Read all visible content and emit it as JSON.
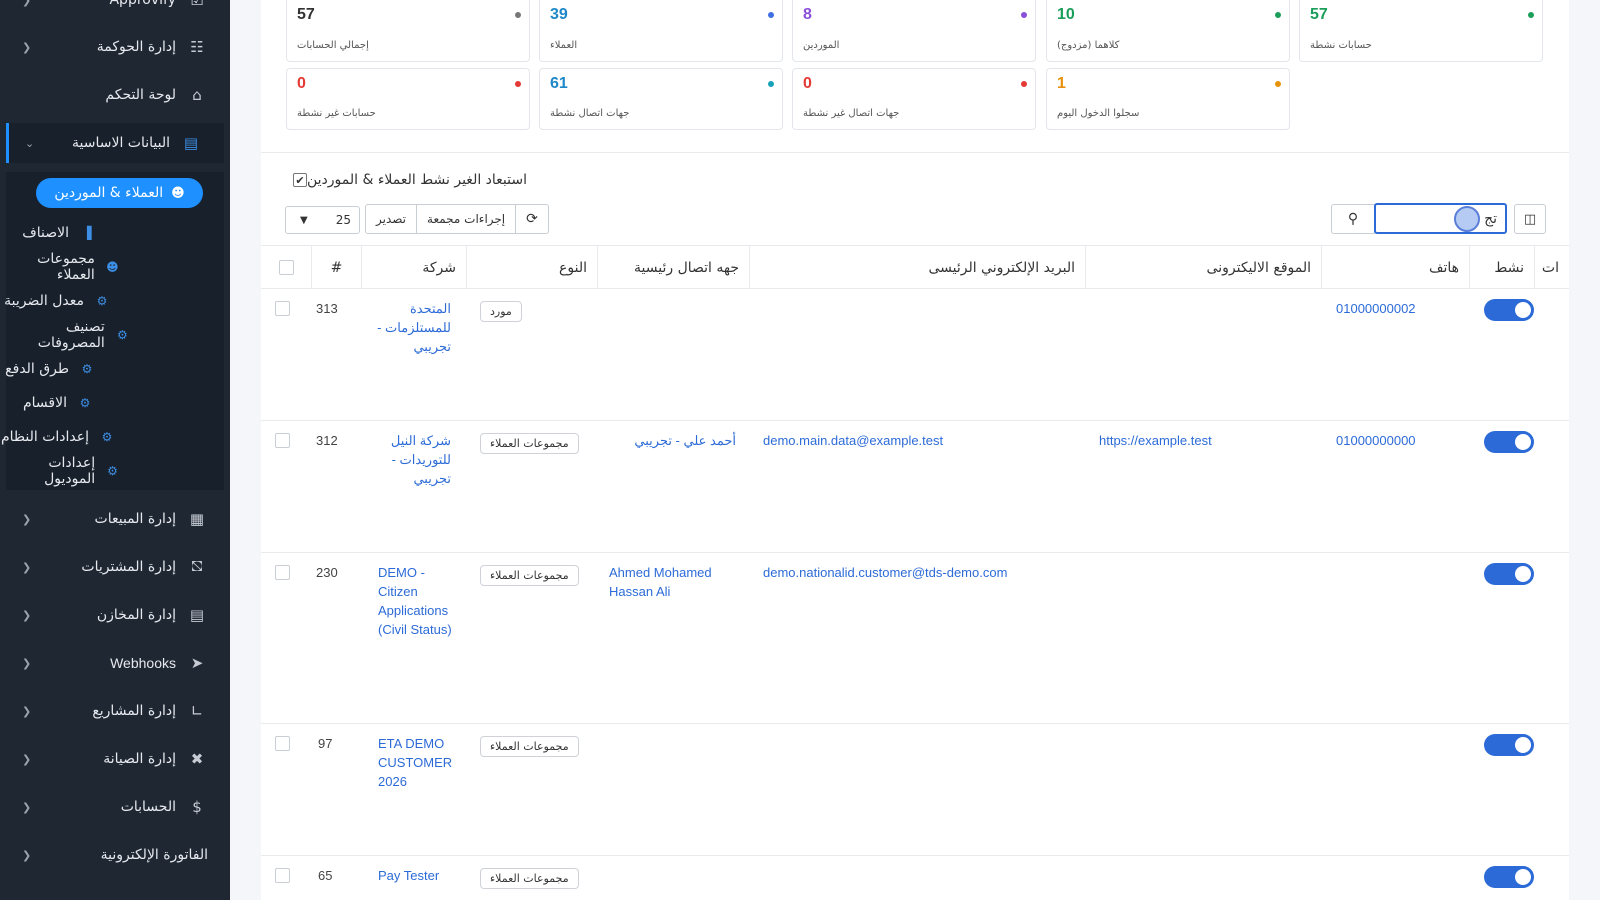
{
  "sidebar": {
    "items": [
      {
        "label": "Approvify",
        "icon": "approval-icon"
      },
      {
        "label": "إدارة الحوكمة",
        "icon": "sitemap-icon"
      },
      {
        "label": "لوحة التحكم",
        "icon": "home-icon"
      },
      {
        "label": "البيانات الاساسية",
        "icon": "bank-icon"
      },
      {
        "label": "إدارة المبيعات",
        "icon": "sales-icon"
      },
      {
        "label": "إدارة المشتريات",
        "icon": "cart-icon"
      },
      {
        "label": "إدارة المخازن",
        "icon": "warehouse-icon"
      },
      {
        "label": "Webhooks",
        "icon": "send-icon"
      },
      {
        "label": "إدارة المشاريع",
        "icon": "chart-icon"
      },
      {
        "label": "إدارة الصيانة",
        "icon": "tools-icon"
      },
      {
        "label": "الحسابات",
        "icon": "dollar-icon"
      },
      {
        "label": "الفاتورة الإلكترونية",
        "icon": "invoice-icon"
      }
    ],
    "subitems": [
      {
        "label": "العملاء & الموردين",
        "icon": "users-icon"
      },
      {
        "label": "الاصناف",
        "icon": "barcode-icon"
      },
      {
        "label": "مجموعات العملاء",
        "icon": "users-icon"
      },
      {
        "label": "معدل الضريبة",
        "icon": "cogs-icon"
      },
      {
        "label": "تصنيف المصروفات",
        "icon": "cogs-icon"
      },
      {
        "label": "طرق الدفع",
        "icon": "cogs-icon"
      },
      {
        "label": "الاقسام",
        "icon": "cogs-icon"
      },
      {
        "label": "إعدادات النظام",
        "icon": "cogs-icon"
      },
      {
        "label": "إعدادات الموديول",
        "icon": "cogs-icon"
      }
    ]
  },
  "stats": [
    {
      "value": "57",
      "label": "إجمالي الحسابات",
      "color": "#333333",
      "dot": "#777777"
    },
    {
      "value": "39",
      "label": "العملاء",
      "color": "#1e88c8",
      "dot": "#3f6fe0"
    },
    {
      "value": "8",
      "label": "الموردين",
      "color": "#8a4fd8",
      "dot": "#8a4fd8"
    },
    {
      "value": "10",
      "label": "كلاهما (مزدوج)",
      "color": "#1b9e5a",
      "dot": "#1b9e5a"
    },
    {
      "value": "57",
      "label": "حسابات نشطة",
      "color": "#1b9e5a",
      "dot": "#1b9e5a"
    },
    {
      "value": "0",
      "label": "حسابات غير نشطة",
      "color": "#e53935",
      "dot": "#e53935"
    },
    {
      "value": "61",
      "label": "جهات اتصال نشطة",
      "color": "#1e88c8",
      "dot": "#17a2b8"
    },
    {
      "value": "0",
      "label": "جهات اتصال غير نشطة",
      "color": "#e53935",
      "dot": "#e53935"
    },
    {
      "value": "1",
      "label": "سجلوا الدخول اليوم",
      "color": "#e8920c",
      "dot": "#e8920c"
    }
  ],
  "filters": {
    "exclude_inactive": "استبعاد الغير نشط العملاء & الموردين",
    "search_value": "تج",
    "per_page": "25",
    "refresh_icon": "refresh-icon",
    "bulk_actions": "إجراءات مجمعة",
    "export": "تصدير"
  },
  "table": {
    "headers": {
      "num": "#",
      "company": "شركة",
      "type": "النوع",
      "contact": "جهه اتصال رئيسية",
      "email": "البريد الإلكتروني الرئيسى",
      "website": "الموقع الاليكترونى",
      "phone": "هاتف",
      "active": "نشط",
      "extra": "ات"
    },
    "rows": [
      {
        "id": "313",
        "company": "المتحدة للمستلزمات - تجريبي",
        "type": "مورد",
        "contact": "",
        "email": "",
        "website": "",
        "phone": "01000000002",
        "active": true
      },
      {
        "id": "312",
        "company": "شركة النيل للتوريدات - تجريبي",
        "type": "مجموعات العملاء",
        "contact": "أحمد علي - تجريبي",
        "email": "demo.main.data@example.test",
        "website": "https://example.test",
        "phone": "01000000000",
        "active": true
      },
      {
        "id": "230",
        "company": "DEMO - Citizen Applications (Civil Status)",
        "type": "مجموعات العملاء",
        "contact": "Ahmed Mohamed Hassan Ali",
        "email": "demo.nationalid.customer@tds-demo.com",
        "website": "",
        "phone": "",
        "active": true
      },
      {
        "id": "97",
        "company": "ETA DEMO CUSTOMER 2026",
        "type": "مجموعات العملاء",
        "contact": "",
        "email": "",
        "website": "",
        "phone": "",
        "active": true
      },
      {
        "id": "65",
        "company": "Pay Tester",
        "type": "مجموعات العملاء",
        "contact": "",
        "email": "",
        "website": "",
        "phone": "",
        "active": true
      }
    ]
  }
}
